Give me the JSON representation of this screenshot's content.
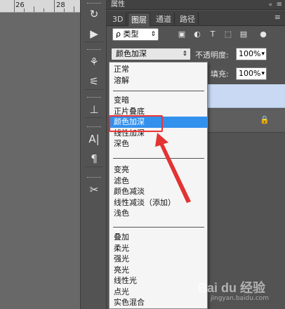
{
  "ruler": {
    "marks": [
      "26",
      "28"
    ]
  },
  "panel": {
    "header_title": "属性",
    "header_collapse": "«",
    "menu_icon": "≡",
    "tabs": [
      {
        "label": "3D"
      },
      {
        "label": "图层"
      },
      {
        "label": "通道"
      },
      {
        "label": "路径"
      }
    ],
    "filter": {
      "kind_label": "ρ 类型",
      "icons": [
        "image-filter-icon",
        "adjustment-filter-icon",
        "text-filter-icon",
        "shape-filter-icon",
        "smart-object-filter-icon"
      ]
    },
    "blend": {
      "selected": "颜色加深"
    },
    "opacity": {
      "label": "不透明度:",
      "value": "100%"
    },
    "fill": {
      "label": "填充:",
      "value": "100%"
    }
  },
  "dropdown": {
    "groups": [
      [
        "正常",
        "溶解"
      ],
      [
        "变暗",
        "正片叠底",
        "颜色加深",
        "线性加深",
        "深色"
      ],
      [
        "变亮",
        "滤色",
        "颜色减淡",
        "线性减淡（添加）",
        "浅色"
      ],
      [
        "叠加",
        "柔光",
        "强光",
        "亮光",
        "线性光",
        "点光",
        "实色混合"
      ]
    ],
    "highlighted": "颜色加深"
  },
  "watermark": {
    "text": "Bai du 经验",
    "sub": "jingyan.baidu.com"
  },
  "colors": {
    "highlight": "#3391ee",
    "annotation": "#e33333"
  }
}
